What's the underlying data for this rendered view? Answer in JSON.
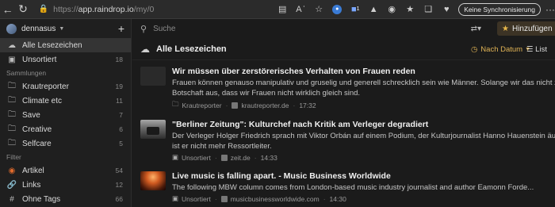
{
  "browser": {
    "url_prefix": "https://",
    "url_domain": "app.raindrop.io",
    "url_path": "/my/0",
    "sync_button": "Keine Synchronisierung",
    "extension_badge": "1"
  },
  "sidebar": {
    "username": "dennasus",
    "items_top": [
      {
        "label": "Alle Lesezeichen",
        "count": "",
        "icon": "cloud-icon",
        "active": true
      },
      {
        "label": "Unsortiert",
        "count": "18",
        "icon": "inbox-icon"
      }
    ],
    "section_collections": "Sammlungen",
    "collections": [
      {
        "label": "Krautreporter",
        "count": "19"
      },
      {
        "label": "Climate etc",
        "count": "11"
      },
      {
        "label": "Save",
        "count": "7"
      },
      {
        "label": "Creative",
        "count": "6"
      },
      {
        "label": "Selfcare",
        "count": "5"
      }
    ],
    "section_filter": "Filter",
    "filters": [
      {
        "label": "Artikel",
        "count": "54",
        "icon": "article-icon"
      },
      {
        "label": "Links",
        "count": "12",
        "icon": "link-icon"
      },
      {
        "label": "Ohne Tags",
        "count": "66",
        "icon": "tag-icon"
      }
    ]
  },
  "main": {
    "search_placeholder": "Suche",
    "add_button": "Hinzufügen",
    "header_title": "Alle Lesezeichen",
    "sort_label": "Nach Datum",
    "view_label": "List",
    "items": [
      {
        "title": "Wir müssen über zerstörerisches Verhalten von Frauen reden",
        "desc1": "Frauen können genauso manipulativ und gruselig und generell schrecklich sein wie Männer. Solange wir das nicht zugeben, senden wir die",
        "desc2": "Botschaft aus, dass wir Frauen nicht wirklich gleich sind.",
        "collection": "Krautreporter",
        "domain": "krautreporter.de",
        "time": "17:32"
      },
      {
        "title": "\"Berliner Zeitung\": Kulturchef nach Kritik am Verleger degradiert",
        "desc1": "Der Verleger Holger Friedrich sprach mit Viktor Orbán auf einem Podium, der Kulturjournalist Hanno Hauenstein äußerte sich kritisch. Nun",
        "desc2": "ist er nicht mehr Ressortleiter.",
        "collection": "Unsortiert",
        "domain": "zeit.de",
        "time": "14:33"
      },
      {
        "title": "Live music is falling apart. - Music Business Worldwide",
        "desc1": "The following MBW column comes from London-based music industry journalist and author Eamonn Forde...",
        "desc2": "",
        "collection": "Unsortiert",
        "domain": "musicbusinessworldwide.com",
        "time": "14:30"
      }
    ]
  }
}
